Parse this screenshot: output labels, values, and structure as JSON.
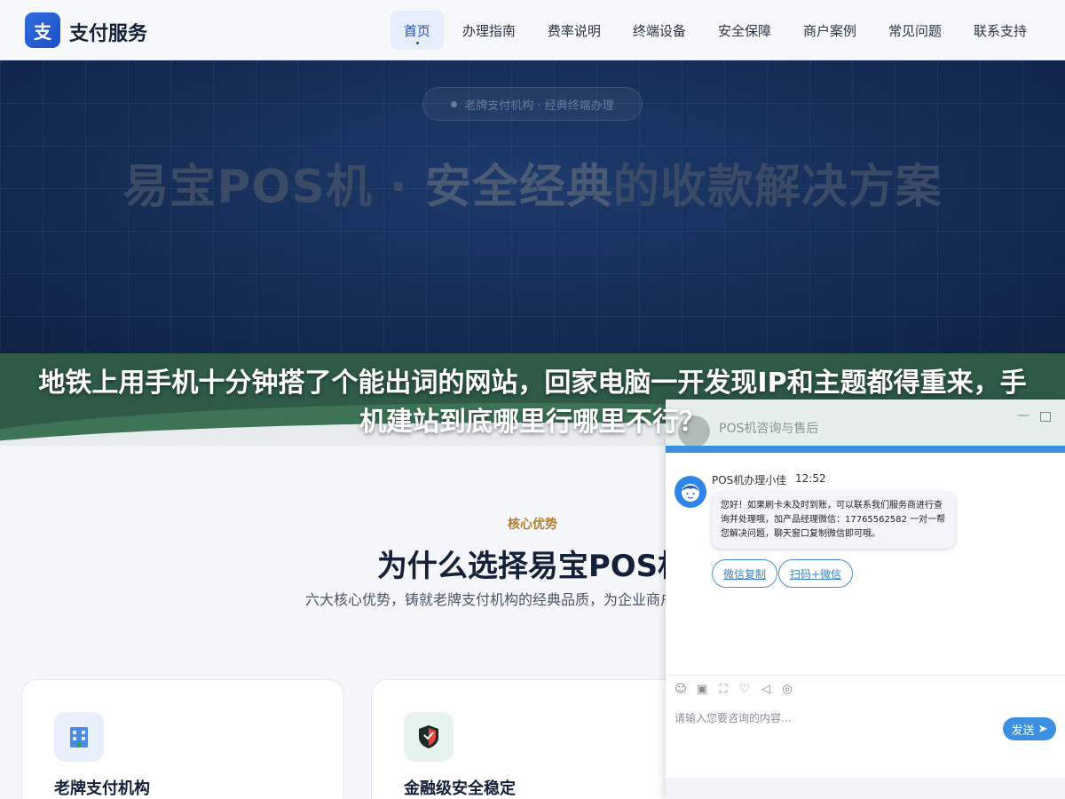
{
  "nav": {
    "logo_char": "支",
    "logo_text": "支付服务",
    "items": [
      {
        "label": "首页"
      },
      {
        "label": "办理指南"
      },
      {
        "label": "费率说明"
      },
      {
        "label": "终端设备"
      },
      {
        "label": "安全保障"
      },
      {
        "label": "商户案例"
      },
      {
        "label": "常见问题"
      },
      {
        "label": "联系支持"
      }
    ],
    "active_index": 0
  },
  "hero": {
    "badge": "老牌支付机构 · 经典终端办理",
    "title_part1": "易宝POS机 · ",
    "title_highlight": "安全经典",
    "title_part2": "的收款解决方案"
  },
  "overlay_headline": "地铁上用手机十分钟搭了个能出词的网站，回家电脑一开发现IP和主题都得重来，手机建站到底哪里行哪里不行？",
  "section": {
    "eyebrow": "核心优势",
    "title": "为什么选择易宝POS机",
    "subtitle": "六大核心优势，铸就老牌支付机构的经典品质，为企业商户提供终端服务",
    "cards": [
      {
        "title": "老牌支付机构",
        "icon": "building-icon"
      },
      {
        "title": "金融级安全稳定",
        "icon": "shield-icon"
      }
    ]
  },
  "chat": {
    "header_title": "POS机咨询与售后",
    "agent_name": "POS机办理小佳",
    "time": "12:52",
    "message": "您好！如果刷卡未及时到账，可以联系我们服务商进行查询并处理哦，加产品经理微信：17765562582 一对一帮您解决问题，聊天窗口复制微信即可哦。",
    "quick_buttons": [
      "微信复制",
      "扫码+微信"
    ],
    "input_placeholder": "请输入您要咨询的内容...",
    "send_label": "发送",
    "tools": [
      "emoji-icon",
      "image-icon",
      "screenshot-icon",
      "evaluate-icon",
      "sound-icon",
      "wechat-icon"
    ]
  },
  "colors": {
    "brand": "#1d4fc4",
    "chat_accent": "#3d8fe0",
    "eyebrow": "#b57d2c",
    "strip": "#2e5a46"
  }
}
